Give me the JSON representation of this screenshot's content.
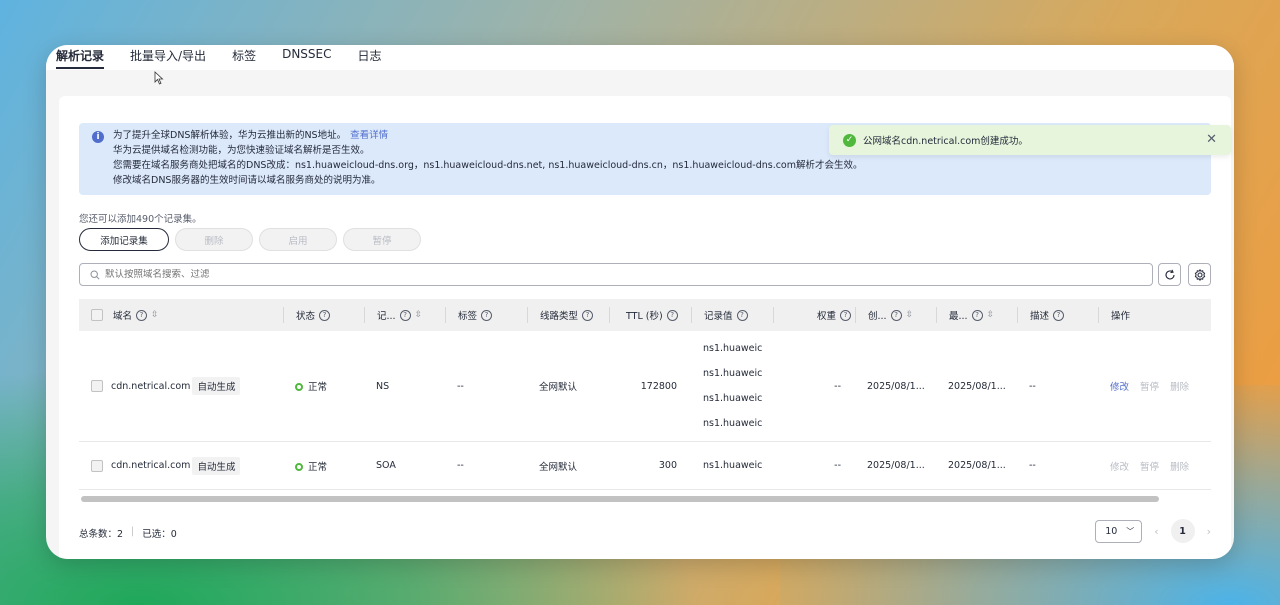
{
  "tabs": [
    "解析记录",
    "批量导入/导出",
    "标签",
    "DNSSEC",
    "日志"
  ],
  "notice": {
    "line1": "为了提升全球DNS解析体验，华为云推出新的NS地址。",
    "link": "查看详情",
    "line2": "华为云提供域名检测功能，为您快速验证域名解析是否生效。",
    "line3": "您需要在域名服务商处把域名的DNS改成：ns1.huaweicloud-dns.org，ns1.huaweicloud-dns.net, ns1.huaweicloud-dns.cn，ns1.huaweicloud-dns.com解析才会生效。",
    "line4": "修改域名DNS服务器的生效时间请以域名服务商处的说明为准。"
  },
  "quota": "您还可以添加490个记录集。",
  "buttons": {
    "add": "添加记录集",
    "delete": "删除",
    "enable": "启用",
    "pause": "暂停"
  },
  "search": {
    "placeholder": "默认按照域名搜索、过滤"
  },
  "columns": {
    "domain": "域名",
    "status": "状态",
    "type": "记...",
    "tag": "标签",
    "line": "线路类型",
    "ttl": "TTL (秒)",
    "value": "记录值",
    "weight": "权重",
    "created": "创...",
    "modified": "最...",
    "desc": "描述",
    "ops": "操作"
  },
  "rows": [
    {
      "domain": "cdn.netrical.com",
      "tag_auto": "自动生成",
      "status": "正常",
      "type": "NS",
      "tag": "--",
      "line": "全网默认",
      "ttl": "172800",
      "v1": "ns1.huaweic",
      "v2": "ns1.huaweic",
      "v3": "ns1.huaweic",
      "v4": "ns1.huaweic",
      "weight": "--",
      "created": "2025/08/1...",
      "modified": "2025/08/1...",
      "desc": "--",
      "op_edit": "修改",
      "op_pause": "暂停",
      "op_delete": "删除"
    },
    {
      "domain": "cdn.netrical.com",
      "tag_auto": "自动生成",
      "status": "正常",
      "type": "SOA",
      "tag": "--",
      "line": "全网默认",
      "ttl": "300",
      "v1": "ns1.huaweic",
      "weight": "--",
      "created": "2025/08/1...",
      "modified": "2025/08/1...",
      "desc": "--",
      "op_edit": "修改",
      "op_pause": "暂停",
      "op_delete": "删除"
    }
  ],
  "footer": {
    "total": "总条数：2",
    "selected": "已选：0"
  },
  "pager": {
    "size": "10",
    "page": "1"
  },
  "toast": {
    "text": "公网域名cdn.netrical.com创建成功。"
  },
  "colors": {
    "accent": "#526ecc",
    "success": "#50b83c",
    "notice_bg": "#dbe9fb",
    "toast_bg": "#e7f5dc"
  }
}
